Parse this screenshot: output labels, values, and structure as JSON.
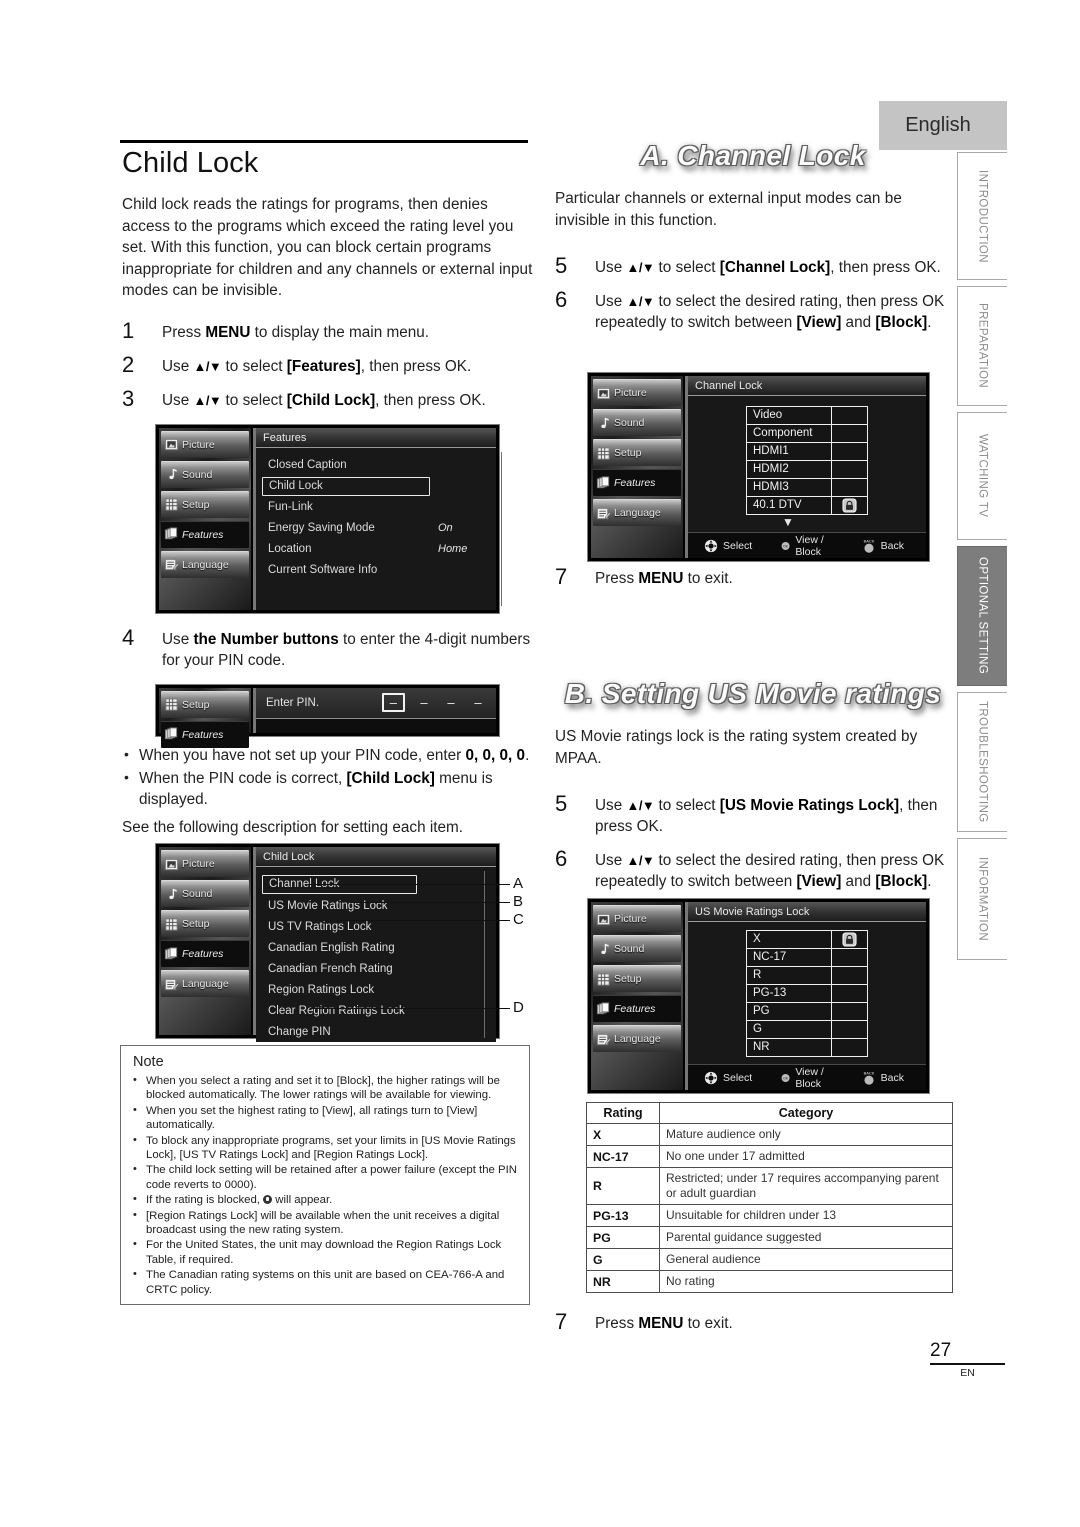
{
  "language_tab": "English",
  "side_tabs": [
    {
      "label": "INTRODUCTION",
      "active": false
    },
    {
      "label": "PREPARATION",
      "active": false
    },
    {
      "label": "WATCHING TV",
      "active": false
    },
    {
      "label": "OPTIONAL SETTING",
      "active": true
    },
    {
      "label": "TROUBLESHOOTING",
      "active": false
    },
    {
      "label": "INFORMATION",
      "active": false
    }
  ],
  "left": {
    "title": "Child Lock",
    "intro": "Child lock reads the ratings for programs, then denies access to the programs which exceed the rating level you set. With this function, you can block certain programs inappropriate for children and any channels or external input modes can be invisible.",
    "step1_num": "1",
    "step1_a": "Press ",
    "step1_menu": "MENU",
    "step1_b": " to display the main menu.",
    "step2_num": "2",
    "step2_a": "Use ",
    "step2_arrows": "▲/▼",
    "step2_b": " to select ",
    "step2_item": "[Features]",
    "step2_c": ", then press OK.",
    "step3_num": "3",
    "step3_a": "Use ",
    "step3_arrows": "▲/▼",
    "step3_b": " to select ",
    "step3_item": "[Child Lock]",
    "step3_c": ", then press OK.",
    "step4_num": "4",
    "step4_a": "Use ",
    "step4_bold": "the Number buttons",
    "step4_b": " to enter the 4-digit numbers for your PIN code.",
    "bullet1_a": "When you have not set up your PIN code, enter ",
    "bullet1_b": "0, 0, 0, 0",
    "bullet1_c": ".",
    "bullet2_a": "When the PIN code is correct, ",
    "bullet2_b": "[Child Lock]",
    "bullet2_c": " menu is displayed.",
    "see_following": "See the following description for setting each item."
  },
  "features_menu": {
    "title": "Features",
    "sidebar": [
      {
        "label": "Picture",
        "icon": "picture-icon",
        "selected": false
      },
      {
        "label": "Sound",
        "icon": "sound-icon",
        "selected": false
      },
      {
        "label": "Setup",
        "icon": "setup-icon",
        "selected": false
      },
      {
        "label": "Features",
        "icon": "features-icon",
        "selected": true
      },
      {
        "label": "Language",
        "icon": "language-icon",
        "selected": false
      }
    ],
    "items": [
      {
        "label": "Closed Caption",
        "value": "",
        "selected": false
      },
      {
        "label": "Child Lock",
        "value": "",
        "selected": true
      },
      {
        "label": "Fun-Link",
        "value": "",
        "selected": false
      },
      {
        "label": "Energy Saving Mode",
        "value": "On",
        "selected": false
      },
      {
        "label": "Location",
        "value": "Home",
        "selected": false
      },
      {
        "label": "Current Software Info",
        "value": "",
        "selected": false
      }
    ]
  },
  "pin_menu": {
    "sidebar": [
      {
        "label": "Setup",
        "icon": "setup-icon",
        "selected": false
      },
      {
        "label": "Features",
        "icon": "features-icon",
        "selected": true
      }
    ],
    "prompt": "Enter PIN.",
    "digits": [
      "–",
      "–",
      "–",
      "–"
    ]
  },
  "childlock_menu": {
    "title": "Child Lock",
    "sidebar": [
      {
        "label": "Picture",
        "icon": "picture-icon",
        "selected": false
      },
      {
        "label": "Sound",
        "icon": "sound-icon",
        "selected": false
      },
      {
        "label": "Setup",
        "icon": "setup-icon",
        "selected": false
      },
      {
        "label": "Features",
        "icon": "features-icon",
        "selected": true
      },
      {
        "label": "Language",
        "icon": "language-icon",
        "selected": false
      }
    ],
    "items": [
      {
        "label": "Channel Lock",
        "selected": true,
        "callout": "A"
      },
      {
        "label": "US Movie Ratings Lock",
        "selected": false,
        "callout": "B"
      },
      {
        "label": "US TV Ratings Lock",
        "selected": false,
        "callout": "C"
      },
      {
        "label": "Canadian English Rating",
        "selected": false,
        "callout": ""
      },
      {
        "label": "Canadian French Rating",
        "selected": false,
        "callout": ""
      },
      {
        "label": "Region Ratings Lock",
        "selected": false,
        "callout": ""
      },
      {
        "label": "Clear Region Ratings Lock",
        "selected": false,
        "callout": ""
      },
      {
        "label": "Change PIN",
        "selected": false,
        "callout": "D"
      }
    ],
    "callouts": [
      "A",
      "B",
      "C",
      "D"
    ]
  },
  "note": {
    "title": "Note",
    "items": [
      "When you select a rating and set it to [Block], the higher ratings will be blocked automatically. The lower ratings will be available for viewing.",
      "When you set the highest rating to [View], all ratings turn to [View] automatically.",
      "To block any inappropriate programs, set your limits in [US Movie Ratings Lock], [US TV Ratings Lock] and [Region Ratings Lock].",
      "The child lock setting will be retained after a power failure (except the PIN code reverts to 0000).",
      "If the rating is blocked,   will appear.",
      "[Region Ratings Lock] will be available when the unit receives a digital broadcast using the new rating system.",
      "For the United States, the unit may download the Region Ratings Lock Table, if required.",
      "The Canadian rating systems on this unit are based on CEA-766-A and CRTC policy."
    ]
  },
  "right": {
    "section_a_title": "A. Channel Lock",
    "section_a_intro": "Particular channels or external input modes can be invisible in this function.",
    "a_step5_num": "5",
    "a_step5_a": "Use ",
    "a_step5_arrows": "▲/▼",
    "a_step5_b": " to select ",
    "a_step5_item": "[Channel Lock]",
    "a_step5_c": ", then press OK.",
    "a_step6_num": "6",
    "a_step6_a": "Use ",
    "a_step6_arrows": "▲/▼",
    "a_step6_b": " to select the desired rating, then press OK repeatedly to switch between ",
    "a_step6_view": "[View]",
    "a_step6_and": " and ",
    "a_step6_block": "[Block]",
    "a_step6_c": ".",
    "a_step7_num": "7",
    "a_step7_a": "Press ",
    "a_step7_menu": "MENU",
    "a_step7_b": " to exit.",
    "section_b_title": "B. Setting US Movie ratings",
    "section_b_intro": "US Movie ratings lock is the rating system created by MPAA.",
    "b_step5_num": "5",
    "b_step5_a": "Use ",
    "b_step5_arrows": "▲/▼",
    "b_step5_b": " to select ",
    "b_step5_item": "[US Movie Ratings Lock]",
    "b_step5_c": ", then press OK.",
    "b_step6_num": "6",
    "b_step6_a": "Use ",
    "b_step6_arrows": "▲/▼",
    "b_step6_b": " to select the desired rating, then press OK repeatedly to switch between ",
    "b_step6_view": "[View]",
    "b_step6_and": " and ",
    "b_step6_block": "[Block]",
    "b_step6_c": ".",
    "b_step7_num": "7",
    "b_step7_a": "Press ",
    "b_step7_menu": "MENU",
    "b_step7_b": " to exit."
  },
  "channel_lock_menu": {
    "title": "Channel Lock",
    "sidebar": [
      {
        "label": "Picture",
        "icon": "picture-icon",
        "selected": false
      },
      {
        "label": "Sound",
        "icon": "sound-icon",
        "selected": false
      },
      {
        "label": "Setup",
        "icon": "setup-icon",
        "selected": false
      },
      {
        "label": "Features",
        "icon": "features-icon",
        "selected": true
      },
      {
        "label": "Language",
        "icon": "language-icon",
        "selected": false
      }
    ],
    "rows": [
      {
        "label": "Video",
        "locked": false
      },
      {
        "label": "Component",
        "locked": false
      },
      {
        "label": "HDMI1",
        "locked": false
      },
      {
        "label": "HDMI2",
        "locked": false
      },
      {
        "label": "HDMI3",
        "locked": false
      },
      {
        "label": "40.1 DTV",
        "locked": true
      }
    ],
    "scroll_arrow": "▼",
    "hints": [
      {
        "icon": "dpad-icon",
        "label": "Select"
      },
      {
        "icon": "ok-button-icon",
        "label": "View / Block"
      },
      {
        "icon": "back-button-icon",
        "label": "Back"
      }
    ]
  },
  "movie_lock_menu": {
    "title": "US Movie Ratings Lock",
    "sidebar": [
      {
        "label": "Picture",
        "icon": "picture-icon",
        "selected": false
      },
      {
        "label": "Sound",
        "icon": "sound-icon",
        "selected": false
      },
      {
        "label": "Setup",
        "icon": "setup-icon",
        "selected": false
      },
      {
        "label": "Features",
        "icon": "features-icon",
        "selected": true
      },
      {
        "label": "Language",
        "icon": "language-icon",
        "selected": false
      }
    ],
    "rows": [
      {
        "label": "X",
        "locked": true
      },
      {
        "label": "NC-17",
        "locked": false
      },
      {
        "label": "R",
        "locked": false
      },
      {
        "label": "PG-13",
        "locked": false
      },
      {
        "label": "PG",
        "locked": false
      },
      {
        "label": "G",
        "locked": false
      },
      {
        "label": "NR",
        "locked": false
      }
    ],
    "hints": [
      {
        "icon": "dpad-icon",
        "label": "Select"
      },
      {
        "icon": "ok-button-icon",
        "label": "View / Block"
      },
      {
        "icon": "back-button-icon",
        "label": "Back"
      }
    ]
  },
  "rating_table": {
    "headers": [
      "Rating",
      "Category"
    ],
    "rows": [
      {
        "rating": "X",
        "category": "Mature audience only"
      },
      {
        "rating": "NC-17",
        "category": "No one under 17 admitted"
      },
      {
        "rating": "R",
        "category": "Restricted; under 17 requires accompanying parent or adult guardian"
      },
      {
        "rating": "PG-13",
        "category": "Unsuitable for children under 13"
      },
      {
        "rating": "PG",
        "category": "Parental guidance suggested"
      },
      {
        "rating": "G",
        "category": "General audience"
      },
      {
        "rating": "NR",
        "category": "No rating"
      }
    ]
  },
  "footer": {
    "page": "27",
    "lang": "EN"
  }
}
